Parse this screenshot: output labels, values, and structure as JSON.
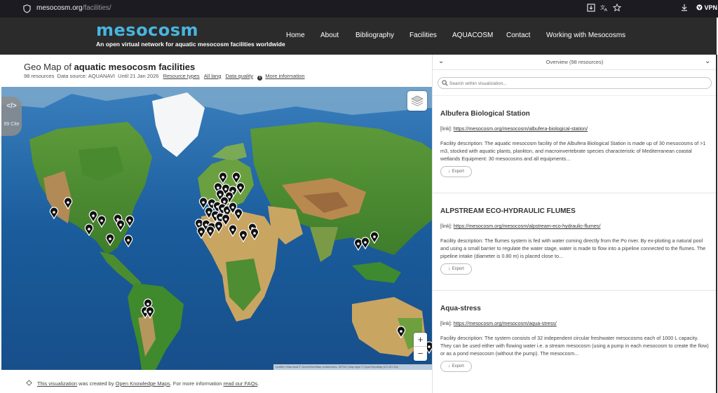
{
  "browser": {
    "url_domain": "mesocosm.org",
    "url_path": "/facilities/",
    "vpn_label": "VPN"
  },
  "header": {
    "logo_text": "mesocosm",
    "tagline": "An open virtual network for aquatic mesocosm facilities worldwide",
    "nav": [
      "Home",
      "About",
      "Bibliography",
      "Facilities",
      "AQUACOSM",
      "Contact",
      "Working with Mesocosms"
    ]
  },
  "map_panel": {
    "title_prefix": "Geo Map of ",
    "title_bold": "aquatic mesocosm facilities",
    "resources_count": "98 resources",
    "data_source": "Data source: AQUANAVI",
    "until": "Until 21 Jan 2026",
    "resource_types": "Resource types",
    "all_lang": "All lang",
    "data_quality": "Data quality",
    "more_info": "More information",
    "embed_icon": "</>",
    "cite_label": "99 Cite",
    "zoom_in": "+",
    "zoom_out": "−",
    "attribution": "Leaflet | Map data © OpenStreetMap contributors, SRTM | Map style © OpenTopoMap (CC-BY-SA)"
  },
  "footer": {
    "link1": "This visualization",
    "text1": " was created by ",
    "link2": "Open Knowledge Maps",
    "text2": ". For more information ",
    "link3": "read our FAQs",
    "text3": "."
  },
  "list_panel": {
    "overview_label": "Overview (98 resources)",
    "search_placeholder": "Search within visualization...",
    "items": [
      {
        "title": "Albufera Biological Station",
        "link_prefix": "[link]: ",
        "link": "https://mesocosm.org/mesocosm/albufera-biological-station/",
        "description": "Facility description: The aquatic mesocosm facility of the Albufera Biological Station is made up of 30 mesocosms of >1 m3, stocked with aquatic plants, plankton, and macroinvertebrate species characteristic of Mediterranean coastal wetlands Equipment: 30 mesocosms and all equipments...",
        "export_label": "Export"
      },
      {
        "title": "ALPSTREAM ECO-HYDRAULIC FLUMES",
        "link_prefix": "[link]: ",
        "link": "https://mesocosm.org/mesocosm/alpstream-eco-hydraulic-flumes/",
        "description": "Facility description: The flumes system is fed with water coming directly from the Po river. By ex-ploiting a natural pool and using a small barrier to regulate the water stage, water is made to flow into a pipeline connected to the flumes. The pipeline intake (diameter is 0.80 m) is placed close to...",
        "export_label": "Export"
      },
      {
        "title": "Aqua-stress",
        "link_prefix": "[link]: ",
        "link": "https://mesocosm.org/mesocosm/aqua-stress/",
        "description": "Facility description: The system consists of 32 independent circular freshwater mesocosms each of 1000 L capacity. They can be used either with flowing water i.e. a stream mesocosm (using a pump in each mesocosm to create the flow) or as a pond mesocosm (without the pump). The mesocosm...",
        "export_label": "Export"
      }
    ]
  },
  "colors": {
    "header_bg": "#2b2b2b",
    "logo": "#48b5e0",
    "browser_bg": "#1c1b22",
    "ocean": "#1d5e9e",
    "marker": "#111111"
  }
}
